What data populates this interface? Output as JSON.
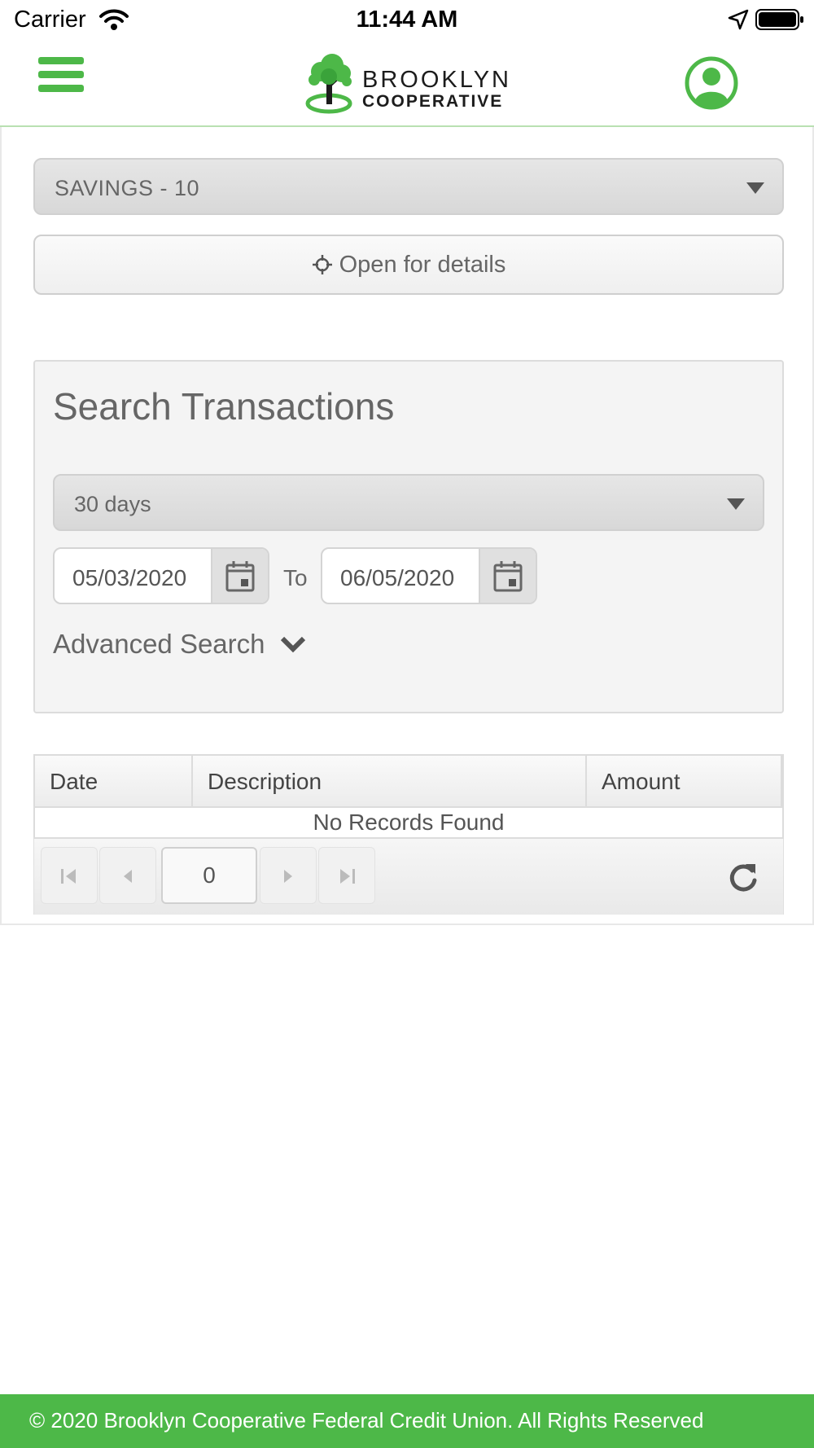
{
  "status_bar": {
    "carrier": "Carrier",
    "time": "11:44 AM"
  },
  "header": {
    "logo_line1": "BROOKLYN",
    "logo_line2": "COOPERATIVE",
    "brand_color": "#4db848"
  },
  "account": {
    "selected": "SAVINGS - 10",
    "details_label": "Open for details"
  },
  "search": {
    "title": "Search Transactions",
    "range_selected": "30 days",
    "date_from": "05/03/2020",
    "to_label": "To",
    "date_to": "06/05/2020",
    "advanced_label": "Advanced Search"
  },
  "grid": {
    "columns": [
      "Date",
      "Description",
      "Amount"
    ],
    "empty_message": "No Records Found",
    "page": "0"
  },
  "footer": {
    "text": "© 2020 Brooklyn Cooperative Federal Credit Union. All Rights Reserved"
  }
}
